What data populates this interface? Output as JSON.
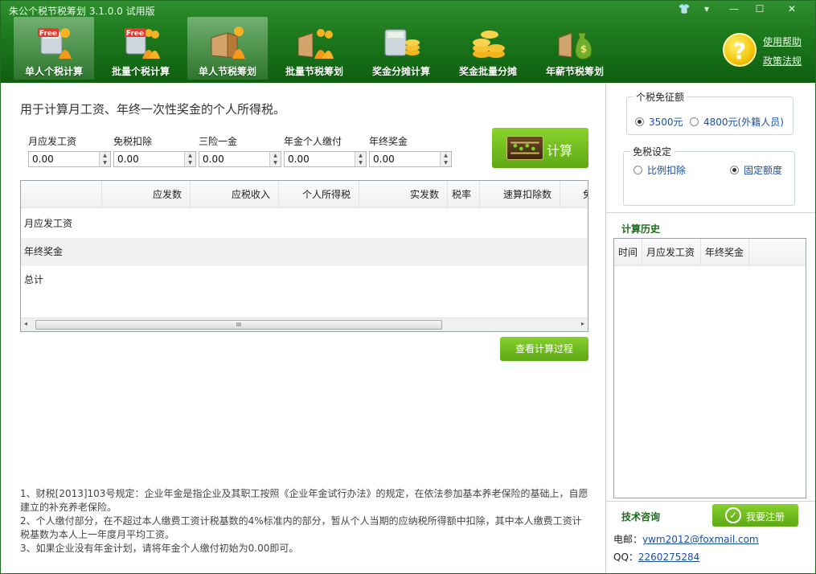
{
  "window": {
    "title": "朱公个税节税筹划 3.1.0.0 试用版",
    "controls": {
      "skin": "👕",
      "menu": "▾",
      "minimize": "—",
      "maximize": "☐",
      "close": "✕"
    }
  },
  "nav": {
    "items": [
      {
        "label": "单人个税计算",
        "icon": "free-calculator-person-icon",
        "badge": "Free"
      },
      {
        "label": "批量个税计算",
        "icon": "free-calculator-group-icon",
        "badge": "Free"
      },
      {
        "label": "单人节税筹划",
        "icon": "book-person-icon"
      },
      {
        "label": "批量节税筹划",
        "icon": "book-group-icon"
      },
      {
        "label": "奖金分摊计算",
        "icon": "calculator-coins-icon"
      },
      {
        "label": "奖金批量分摊",
        "icon": "coins-stack-icon"
      },
      {
        "label": "年薪节税筹划",
        "icon": "money-bag-icon"
      }
    ]
  },
  "help": {
    "badge": "?",
    "help_link": "使用帮助",
    "policy_link": "政策法规"
  },
  "intro": "用于计算月工资、年终一次性奖金的个人所得税。",
  "fields": [
    {
      "label": "月应发工资",
      "value": "0.00"
    },
    {
      "label": "免税扣除",
      "value": "0.00"
    },
    {
      "label": "三险一金",
      "value": "0.00"
    },
    {
      "label": "年金个人缴付",
      "value": "0.00"
    },
    {
      "label": "年终奖金",
      "value": "0.00"
    }
  ],
  "calc_button": "计算",
  "grid": {
    "columns": [
      "应发数",
      "应税收入",
      "个人所得税",
      "实发数",
      "税率",
      "速算扣除数",
      "免"
    ],
    "rows": [
      "月应发工资",
      "年终奖金",
      "总计"
    ],
    "scroll_thumb": "III",
    "scroll_left": "◂",
    "scroll_right": "▸"
  },
  "view_process_button": "查看计算过程",
  "notes": [
    "1、财税[2013]103号规定：企业年金是指企业及其职工按照《企业年金试行办法》的规定，在依法参加基本养老保险的基础上，自愿建立的补充养老保险。",
    "2、个人缴付部分，在不超过本人缴费工资计税基数的4%标准内的部分，暂从个人当期的应纳税所得额中扣除，其中本人缴费工资计税基数为本人上一年度月平均工资。",
    "3、如果企业没有年金计划，请将年金个人缴付初始为0.00即可。"
  ],
  "tax_threshold": {
    "title": "个税免征额",
    "options": [
      "3500元",
      "4800元(外籍人员)"
    ],
    "selected_index": 0
  },
  "exemption": {
    "title": "免税设定",
    "options": [
      "比例扣除",
      "固定额度"
    ],
    "selected_index": 1
  },
  "history": {
    "title": "计算历史",
    "columns": [
      "时间",
      "月应发工资",
      "年终奖金"
    ]
  },
  "support": {
    "title": "技术咨询",
    "register_button": "我要注册",
    "email_label": "电邮：",
    "email": "ywm2012@foxmail.com",
    "qq_label": "QQ：",
    "qq": "2260275284"
  },
  "colors": {
    "header_green": "#1d7a1d",
    "button_green": "#6dbb1f",
    "link_blue": "#1a4fa3",
    "section_green": "#1a6b1a"
  }
}
